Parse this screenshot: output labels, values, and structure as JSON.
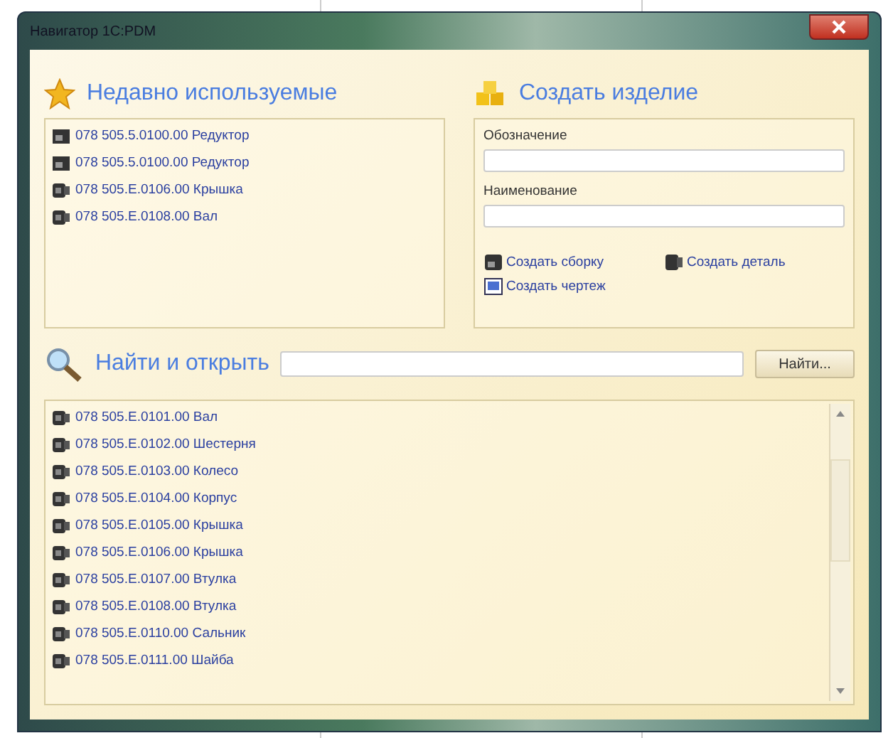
{
  "window": {
    "title": "Навигатор 1С:PDM"
  },
  "recent": {
    "title": "Недавно используемые",
    "items": [
      {
        "kind": "assembly",
        "label": "078 505.5.0100.00 Редуктор"
      },
      {
        "kind": "assembly",
        "label": "078 505.5.0100.00 Редуктор"
      },
      {
        "kind": "part",
        "label": "078 505.Е.0106.00 Крышка"
      },
      {
        "kind": "part",
        "label": "078 505.Е.0108.00 Вал"
      }
    ]
  },
  "create": {
    "title": "Создать изделие",
    "fields": [
      {
        "label": "Обозначение"
      },
      {
        "label": "Наименование"
      }
    ],
    "links": [
      {
        "kind": "assembly",
        "label": "Создать сборку"
      },
      {
        "kind": "part",
        "label": "Создать деталь"
      },
      {
        "kind": "drawing",
        "label": "Создать чертеж"
      }
    ]
  },
  "search": {
    "title": "Найти и открыть",
    "button": "Найти...",
    "results": [
      {
        "kind": "part",
        "label": "078 505.Е.0101.00 Вал"
      },
      {
        "kind": "part",
        "label": "078 505.Е.0102.00 Шестерня"
      },
      {
        "kind": "part",
        "label": "078 505.Е.0103.00 Колесо"
      },
      {
        "kind": "part",
        "label": "078 505.Е.0104.00 Корпус"
      },
      {
        "kind": "part",
        "label": "078 505.Е.0105.00 Крышка"
      },
      {
        "kind": "part",
        "label": "078 505.Е.0106.00 Крышка"
      },
      {
        "kind": "part",
        "label": "078 505.Е.0107.00 Втулка"
      },
      {
        "kind": "part",
        "label": "078 505.Е.0108.00 Втулка"
      },
      {
        "kind": "part",
        "label": "078 505.Е.0110.00 Сальник"
      },
      {
        "kind": "part",
        "label": "078 505.Е.0111.00 Шайба"
      }
    ]
  }
}
